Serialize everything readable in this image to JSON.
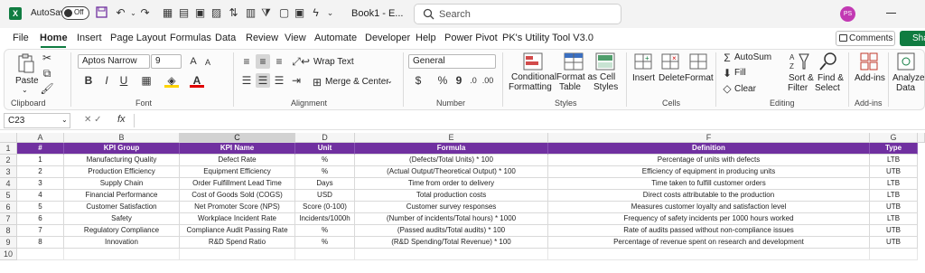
{
  "titlebar": {
    "autosave_label": "AutoSave",
    "autosave_state": "Off",
    "doc_title": "Book1 - E...",
    "search_placeholder": "Search",
    "avatar_initials": "PS"
  },
  "menu": {
    "items": [
      "File",
      "Home",
      "Insert",
      "Page Layout",
      "Formulas",
      "Data",
      "Review",
      "View",
      "Automate",
      "Developer",
      "Help",
      "Power Pivot",
      "PK's Utility Tool V3.0"
    ],
    "active": "Home",
    "comments_label": "Comments",
    "share_label": "Sha"
  },
  "ribbon": {
    "clipboard": {
      "paste": "Paste",
      "label": "Clipboard"
    },
    "font": {
      "name": "Aptos Narrow",
      "size": "9",
      "label": "Font",
      "bold": "B",
      "italic": "I",
      "underline": "U"
    },
    "alignment": {
      "wrap_text": "Wrap Text",
      "merge_center": "Merge & Center",
      "label": "Alignment"
    },
    "number": {
      "format": "General",
      "currency": "$",
      "percent": "%",
      "comma": "9",
      "label": "Number"
    },
    "styles": {
      "conditional": [
        "Conditional",
        "Formatting"
      ],
      "format_table": [
        "Format as",
        "Table"
      ],
      "cell_styles": [
        "Cell",
        "Styles"
      ],
      "label": "Styles"
    },
    "cells": {
      "insert": "Insert",
      "delete": "Delete",
      "format": "Format",
      "label": "Cells"
    },
    "editing": {
      "autosum": "AutoSum",
      "fill": "Fill",
      "clear": "Clear",
      "sort_filter": [
        "Sort &",
        "Filter"
      ],
      "find_select": [
        "Find &",
        "Select"
      ],
      "label": "Editing"
    },
    "addins": {
      "addins": "Add-ins",
      "label": "Add-ins"
    },
    "analyze": {
      "label": [
        "Analyze",
        "Data"
      ]
    }
  },
  "formula_bar": {
    "name_box": "C23",
    "fx": "fx",
    "value": ""
  },
  "grid": {
    "columns": [
      "A",
      "B",
      "C",
      "D",
      "E",
      "F",
      "G"
    ],
    "selected_column": "C",
    "row_numbers": [
      "1",
      "2",
      "3",
      "4",
      "5",
      "6",
      "7",
      "8",
      "9",
      "10"
    ],
    "header": [
      "#",
      "KPI Group",
      "KPI Name",
      "Unit",
      "Formula",
      "Definition",
      "Type"
    ],
    "rows": [
      [
        "1",
        "Manufacturing Quality",
        "Defect Rate",
        "%",
        "(Defects/Total Units) * 100",
        "Percentage of units with defects",
        "LTB"
      ],
      [
        "2",
        "Production Efficiency",
        "Equipment Efficiency",
        "%",
        "(Actual Output/Theoretical Output) * 100",
        "Efficiency of equipment in producing units",
        "UTB"
      ],
      [
        "3",
        "Supply Chain",
        "Order Fulfillment Lead Time",
        "Days",
        "Time from order to delivery",
        "Time taken to fulfill customer orders",
        "LTB"
      ],
      [
        "4",
        "Financial Performance",
        "Cost of Goods Sold (COGS)",
        "USD",
        "Total production costs",
        "Direct costs attributable to the production",
        "LTB"
      ],
      [
        "5",
        "Customer Satisfaction",
        "Net Promoter Score (NPS)",
        "Score (0-100)",
        "Customer survey responses",
        "Measures customer loyalty and satisfaction level",
        "UTB"
      ],
      [
        "6",
        "Safety",
        "Workplace Incident Rate",
        "Incidents/1000h",
        "(Number of incidents/Total hours) * 1000",
        "Frequency of safety incidents per 1000 hours worked",
        "LTB"
      ],
      [
        "7",
        "Regulatory Compliance",
        "Compliance Audit Passing Rate",
        "%",
        "(Passed audits/Total audits) * 100",
        "Rate of audits passed without non-compliance issues",
        "UTB"
      ],
      [
        "8",
        "Innovation",
        "R&D Spend Ratio",
        "%",
        "(R&D Spending/Total Revenue) * 100",
        "Percentage of revenue spent on research and development",
        "UTB"
      ]
    ]
  },
  "colors": {
    "header_fill": "#7030a0",
    "accent": "#107c41",
    "avatar": "#c239b3"
  }
}
